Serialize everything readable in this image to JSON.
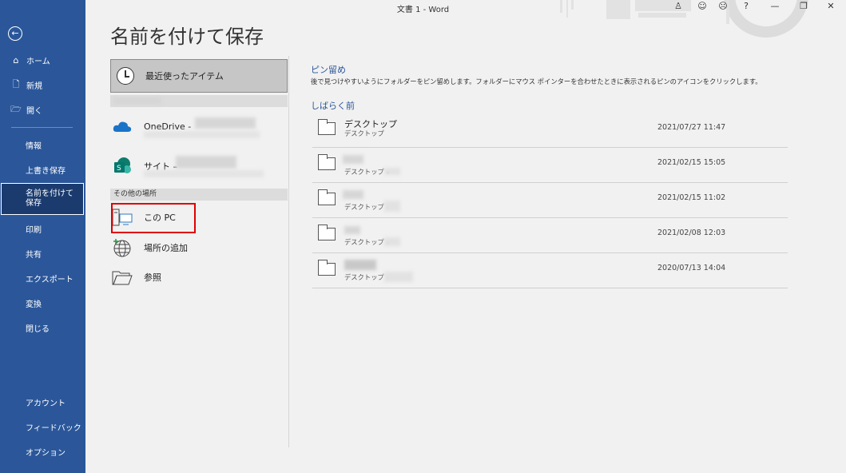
{
  "window": {
    "title": "文書 1  -  Word"
  },
  "sidebar": {
    "items": [
      {
        "label": "ホーム",
        "icon": "home-icon"
      },
      {
        "label": "新規",
        "icon": "new-doc-icon"
      },
      {
        "label": "開く",
        "icon": "open-folder-icon"
      },
      {
        "label": "情報"
      },
      {
        "label": "上書き保存"
      },
      {
        "label": "名前を付けて保存",
        "active": true
      },
      {
        "label": "印刷"
      },
      {
        "label": "共有"
      },
      {
        "label": "エクスポート"
      },
      {
        "label": "変換"
      },
      {
        "label": "閉じる"
      },
      {
        "label": "アカウント"
      },
      {
        "label": "フィードバック"
      },
      {
        "label": "オプション"
      }
    ]
  },
  "page_title": "名前を付けて保存",
  "locations": {
    "recent": "最近使ったアイテム",
    "onedrive": "OneDrive -",
    "site": "サイト –",
    "other_header": "その他の場所",
    "this_pc": "この PC",
    "add_place": "場所の追加",
    "browse": "参照"
  },
  "pinned": {
    "header": "ピン留め",
    "description": "後で見つけやすいようにフォルダーをピン留めします。フォルダーにマウス ポインターを合わせたときに表示されるピンのアイコンをクリックします。"
  },
  "older": {
    "header": "しばらく前",
    "rows": [
      {
        "name": "デスクトップ",
        "path": "デスクトップ",
        "date": "2021/07/27 11:47"
      },
      {
        "name": "",
        "path": "デスクトップ »",
        "date": "2021/02/15 15:05"
      },
      {
        "name": "",
        "path": "デスクトップ »",
        "date": "2021/02/15 11:02"
      },
      {
        "name": "",
        "path": "デスクトップ »",
        "date": "2021/02/08 12:03"
      },
      {
        "name": "",
        "path": "デスクトップ »",
        "date": "2020/07/13 14:04"
      }
    ]
  },
  "colors": {
    "sidebar": "#2b579a",
    "accent": "#2b579a",
    "highlight": "#e00000"
  }
}
